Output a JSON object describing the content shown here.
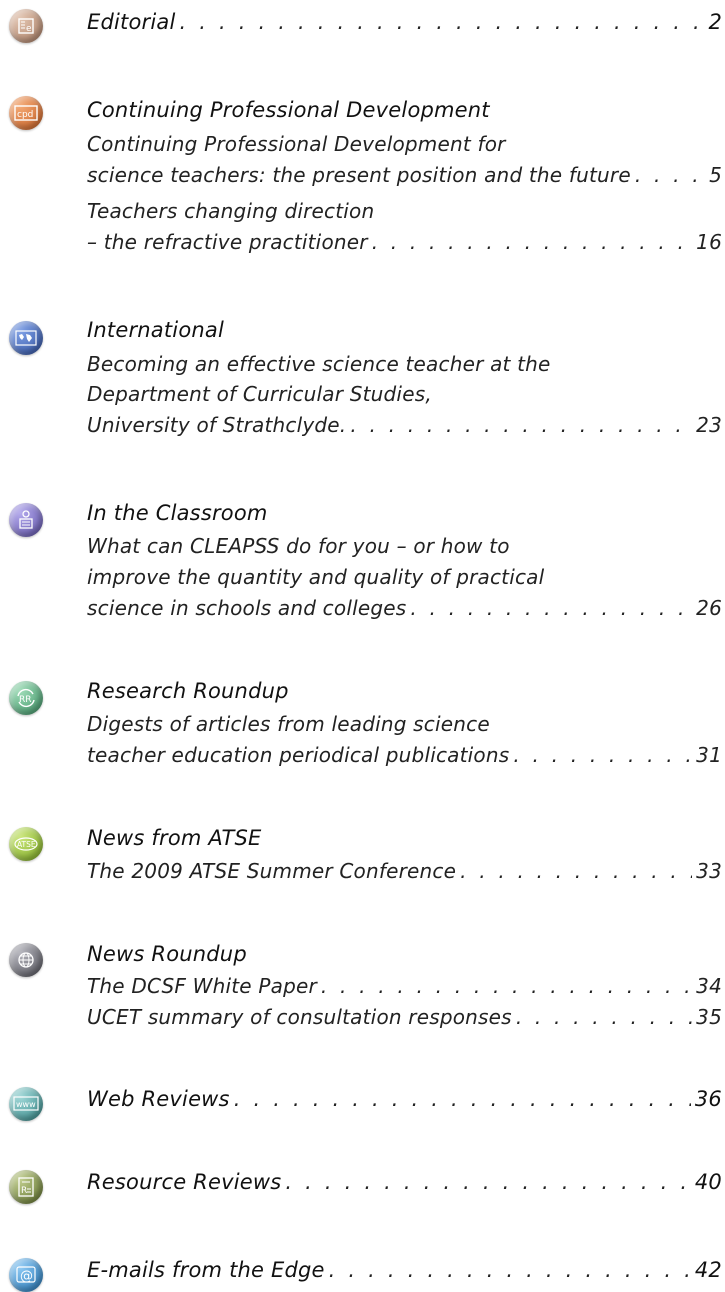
{
  "colors": {
    "editorial": "#b98e74",
    "cpd": "#d9783b",
    "international": "#3d63b8",
    "classroom": "#7c6fc4",
    "research": "#59b07f",
    "atse": "#8fbf33",
    "news": "#6a6a72",
    "web": "#4fa3a3",
    "resource": "#7d8f45",
    "email": "#3a8fd1"
  },
  "icons": {
    "editorial": "document-e-icon",
    "cpd": "cpd-badge-icon",
    "international": "world-map-icon",
    "classroom": "teacher-classroom-icon",
    "research": "rr-cycle-icon",
    "atse": "atse-badge-icon",
    "news": "globe-icon",
    "web": "www-icon",
    "resource": "resource-book-icon",
    "email": "at-sign-icon"
  },
  "contents": {
    "editorial": {
      "title": "Editorial",
      "page": "2"
    },
    "cpd": {
      "title": "Continuing Professional Development",
      "a1_line1": "Continuing Professional Development for",
      "a1_line2": "science teachers: the present position and the future",
      "a1_page": "5",
      "a2_line1": "Teachers changing direction",
      "a2_line2": "– the refractive practitioner",
      "a2_page": "16"
    },
    "international": {
      "title": "International",
      "line1": "Becoming an effective science teacher at the",
      "line2": "Department of Curricular Studies,",
      "line3": "University of Strathclyde.",
      "page": "23"
    },
    "classroom": {
      "title": "In the Classroom",
      "line1": "What can CLEAPSS do for you – or how to",
      "line2": "improve the quantity and quality of practical",
      "line3": "science in schools and colleges",
      "page": "26"
    },
    "research": {
      "title": "Research Roundup",
      "line1": "Digests of articles from leading science",
      "line2": "teacher education periodical publications",
      "page": "31"
    },
    "atse": {
      "title": "News from ATSE",
      "line1": "The 2009 ATSE Summer Conference",
      "page": "33"
    },
    "news": {
      "title": "News Roundup",
      "a1": "The DCSF White Paper",
      "a1_page": "34",
      "a2": "UCET summary of consultation responses",
      "a2_page": "35"
    },
    "web": {
      "title": "Web Reviews",
      "page": "36"
    },
    "resource": {
      "title": "Resource Reviews",
      "page": "40"
    },
    "email": {
      "title": "E-mails from the Edge",
      "page": "42"
    }
  },
  "icon_text": {
    "cpd": "cpd",
    "research": "RR",
    "atse": "ATSE",
    "web": "www",
    "resource": "R",
    "email": "@",
    "editorial": "e"
  }
}
